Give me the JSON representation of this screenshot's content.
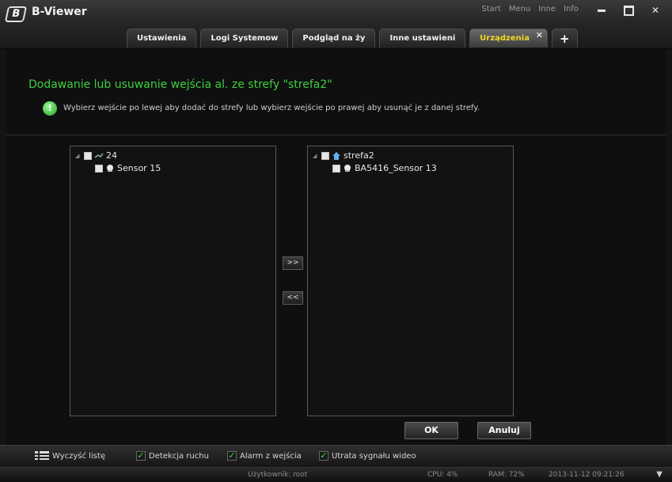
{
  "app": {
    "title": "B-Viewer",
    "logo_letter": "B"
  },
  "top_menu": [
    "Start",
    "Menu",
    "Inne",
    "Info"
  ],
  "tabs": [
    {
      "label": "Ustawienia"
    },
    {
      "label": "Logi Systemow"
    },
    {
      "label": "Podgląd na ży"
    },
    {
      "label": "Inne ustawieni"
    },
    {
      "label": "Urządzenia",
      "active": true
    },
    {
      "label": "+"
    }
  ],
  "dialog": {
    "heading": "Dodawanie lub usuwanie wejścia al. ze strefy \"strefa2\"",
    "hint": "Wybierz wejście po lewej aby dodać do strefy lub wybierz wejście po prawej aby usunąć je z danej strefy.",
    "left_tree": {
      "root": "24",
      "children": [
        "Sensor 15"
      ]
    },
    "right_tree": {
      "root": "strefa2",
      "children": [
        "BA5416_Sensor 13"
      ]
    },
    "move_right": ">>",
    "move_left": "<<",
    "ok": "OK",
    "cancel": "Anuluj"
  },
  "bottom_bar": {
    "clear_list": "Wyczyść listę",
    "filters": [
      {
        "label": "Detekcja ruchu",
        "checked": true
      },
      {
        "label": "Alarm z wejścia",
        "checked": true
      },
      {
        "label": "Utrata sygnału wideo",
        "checked": true
      }
    ]
  },
  "status": {
    "user": "Użytkownik: root",
    "cpu": "CPU: 4%",
    "ram": "RAM: 72%",
    "datetime": "2013-11-12 09:21:26"
  },
  "colors": {
    "heading": "#3ecf3e",
    "active_tab": "#f4d92a",
    "check": "#4ad84a"
  }
}
